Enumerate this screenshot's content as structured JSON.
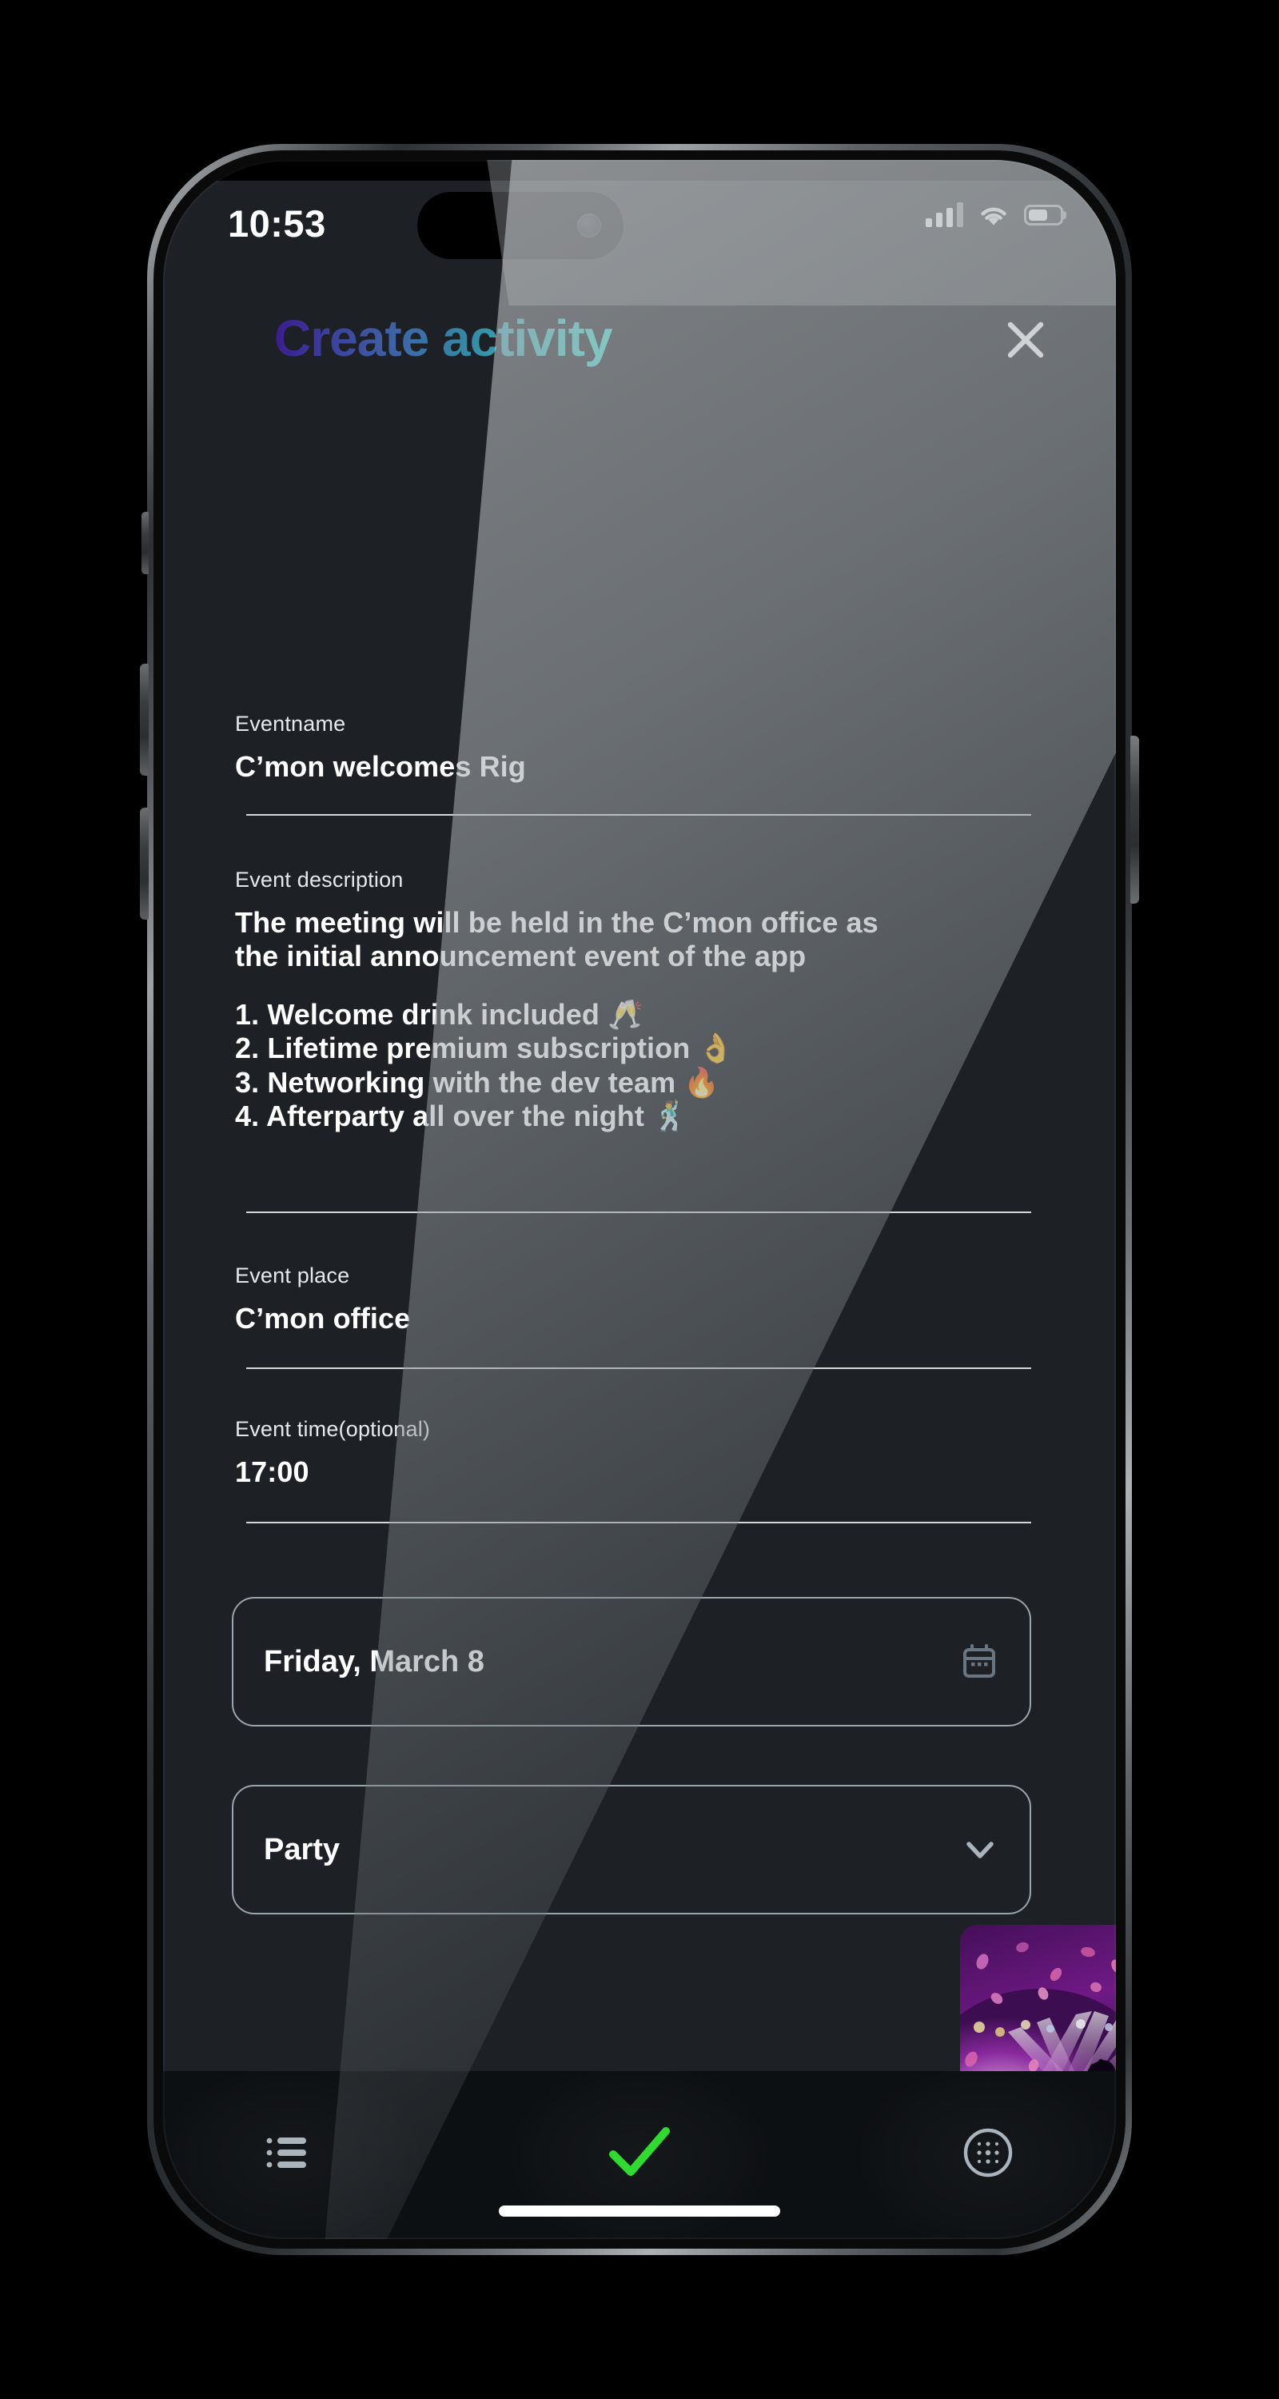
{
  "status_bar": {
    "time": "10:53",
    "icons": [
      "cellular-signal-icon",
      "wifi-icon",
      "battery-icon"
    ]
  },
  "header": {
    "title": "Create activity",
    "close_label": "close-icon",
    "gradient_from": "#3a1b8c",
    "gradient_to": "#3ed9cb"
  },
  "fields": {
    "event_name": {
      "label": "Eventname",
      "value": "C’mon welcomes Rig",
      "clear_label": "×"
    },
    "event_description": {
      "label": "Event description",
      "lines": [
        "The meeting will be held in the C’mon office as",
        "the initial announcement event of the app",
        "",
        "1. Welcome drink included 🥂",
        "2. Lifetime premium subscription 👌",
        "3. Networking with the dev team 🔥",
        "4. Afterparty all over the night 🕺"
      ],
      "clear_label": "×"
    },
    "event_place": {
      "label": "Event place",
      "value": "C’mon office",
      "clear_label": "×"
    },
    "event_time": {
      "label": "Event time(optional)",
      "value": "17:00",
      "clear_label": "×"
    }
  },
  "pickers": {
    "date": {
      "value": "Friday, March 8",
      "icon": "calendar-icon"
    },
    "category": {
      "value": "Party",
      "icon": "chevron-down-icon"
    }
  },
  "attachment": {
    "name": "event-cover-photo",
    "alt": "Concert crowd with purple stage lights and confetti",
    "remove_label": "×"
  },
  "bottom_nav": {
    "items": [
      {
        "name": "list-icon",
        "label": "List"
      },
      {
        "name": "check-icon",
        "label": "Confirm"
      },
      {
        "name": "grid-apps-icon",
        "label": "Apps"
      }
    ],
    "accent_color": "#2fdb2f"
  },
  "theme": {
    "screen_bg": "#1d2125",
    "nav_bg": "#0d1013",
    "text_primary": "#ffffff",
    "text_muted": "#8d99a6",
    "border": "#9aa5ae"
  }
}
